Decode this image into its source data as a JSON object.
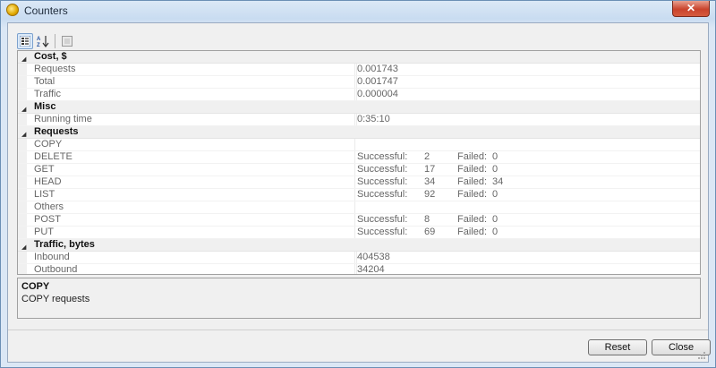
{
  "window": {
    "title": "Counters",
    "close_symbol": "✕"
  },
  "grid": {
    "categories": [
      {
        "name": "Cost, $",
        "props": [
          {
            "name": "Requests",
            "value": "0.001743"
          },
          {
            "name": "Total",
            "value": "0.001747"
          },
          {
            "name": "Traffic",
            "value": "0.000004"
          }
        ]
      },
      {
        "name": "Misc",
        "props": [
          {
            "name": "Running time",
            "value": "0:35:10"
          }
        ]
      },
      {
        "name": "Requests",
        "props": [
          {
            "name": "COPY"
          },
          {
            "name": "DELETE",
            "ok_label": "Successful:",
            "ok": "2",
            "fail_label": "Failed:",
            "fail": "0"
          },
          {
            "name": "GET",
            "ok_label": "Successful:",
            "ok": "17",
            "fail_label": "Failed:",
            "fail": "0"
          },
          {
            "name": "HEAD",
            "ok_label": "Successful:",
            "ok": "34",
            "fail_label": "Failed:",
            "fail": "34"
          },
          {
            "name": "LIST",
            "ok_label": "Successful:",
            "ok": "92",
            "fail_label": "Failed:",
            "fail": "0"
          },
          {
            "name": "Others"
          },
          {
            "name": "POST",
            "ok_label": "Successful:",
            "ok": "8",
            "fail_label": "Failed:",
            "fail": "0"
          },
          {
            "name": "PUT",
            "ok_label": "Successful:",
            "ok": "69",
            "fail_label": "Failed:",
            "fail": "0"
          }
        ]
      },
      {
        "name": "Traffic, bytes",
        "props": [
          {
            "name": "Inbound",
            "value": "404538"
          },
          {
            "name": "Outbound",
            "value": "34204"
          }
        ]
      }
    ]
  },
  "description": {
    "title": "COPY",
    "text": "COPY requests"
  },
  "buttons": {
    "reset": "Reset",
    "close": "Close"
  },
  "colors": {
    "accent": "#6b8fb5",
    "close": "#c9432c"
  }
}
